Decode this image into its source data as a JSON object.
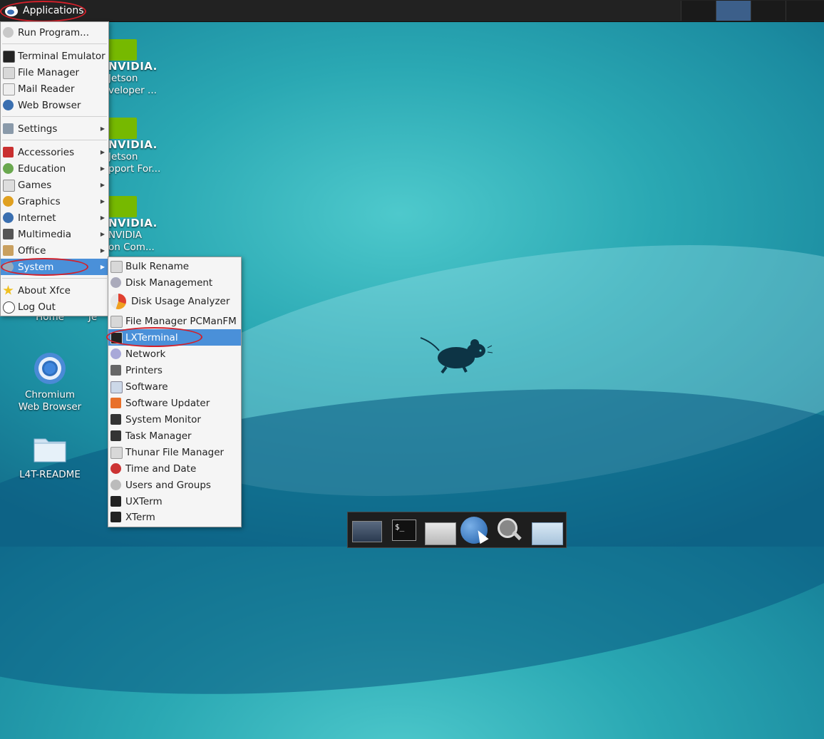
{
  "panel": {
    "applications_label": "Applications"
  },
  "desktop": {
    "nvidia_icons": [
      {
        "brand": "NVIDIA.",
        "line1": "Jetson",
        "line2": "veloper ..."
      },
      {
        "brand": "NVIDIA.",
        "line1": "Jetson",
        "line2": "pport For..."
      },
      {
        "brand": "NVIDIA.",
        "line1": "NVIDIA",
        "line2": "on Com..."
      }
    ],
    "home_label": "Home",
    "jetson_partial": "Je",
    "chromium_line1": "Chromium",
    "chromium_line2": "Web Browser",
    "readme_label": "L4T-README"
  },
  "app_menu": {
    "items": [
      {
        "label": "Run Program...",
        "icon": "run-icon"
      },
      {
        "label": "Terminal Emulator",
        "icon": "terminal-icon"
      },
      {
        "label": "File Manager",
        "icon": "folder-icon"
      },
      {
        "label": "Mail Reader",
        "icon": "mail-icon"
      },
      {
        "label": "Web Browser",
        "icon": "globe-icon"
      },
      {
        "label": "Settings",
        "icon": "settings-icon"
      },
      {
        "label": "Accessories",
        "icon": "accessories-icon"
      },
      {
        "label": "Education",
        "icon": "education-icon"
      },
      {
        "label": "Games",
        "icon": "games-icon"
      },
      {
        "label": "Graphics",
        "icon": "graphics-icon"
      },
      {
        "label": "Internet",
        "icon": "internet-icon"
      },
      {
        "label": "Multimedia",
        "icon": "multimedia-icon"
      },
      {
        "label": "Office",
        "icon": "office-icon"
      },
      {
        "label": "System",
        "icon": "system-icon"
      },
      {
        "label": "About Xfce",
        "icon": "star-icon"
      },
      {
        "label": "Log Out",
        "icon": "power-icon"
      }
    ]
  },
  "system_menu": {
    "items": [
      {
        "label": "Bulk Rename"
      },
      {
        "label": "Disk Management"
      },
      {
        "label": "Disk Usage Analyzer"
      },
      {
        "label": "File Manager PCManFM"
      },
      {
        "label": "LXTerminal"
      },
      {
        "label": "Network"
      },
      {
        "label": "Printers"
      },
      {
        "label": "Software"
      },
      {
        "label": "Software Updater"
      },
      {
        "label": "System Monitor"
      },
      {
        "label": "Task Manager"
      },
      {
        "label": "Thunar File Manager"
      },
      {
        "label": "Time and Date"
      },
      {
        "label": "Users and Groups"
      },
      {
        "label": "UXTerm"
      },
      {
        "label": "XTerm"
      }
    ]
  },
  "dock": {
    "terminal_glyph": "$_"
  },
  "colors": {
    "highlight": "#4a90d9",
    "annotation_ring": "#d2202a",
    "nvidia_green": "#76b900"
  }
}
